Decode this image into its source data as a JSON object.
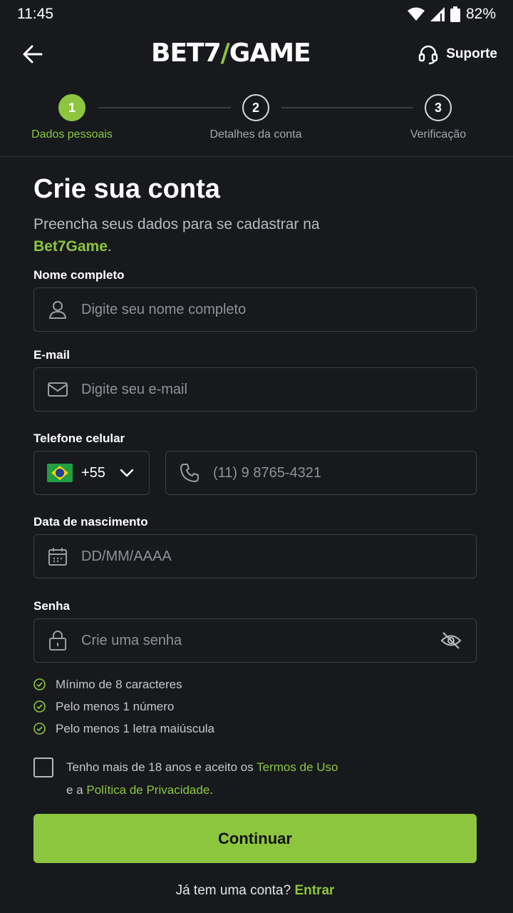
{
  "status_bar": {
    "time": "11:45",
    "battery": "82%"
  },
  "header": {
    "logo_part1": "BET7",
    "logo_part2": "GAME",
    "support_label": "Suporte"
  },
  "stepper": {
    "steps": [
      {
        "number": "1",
        "label": "Dados pessoais",
        "active": true
      },
      {
        "number": "2",
        "label": "Detalhes da conta",
        "active": false
      },
      {
        "number": "3",
        "label": "Verificação",
        "active": false
      }
    ]
  },
  "form": {
    "title": "Crie sua conta",
    "subtitle_prefix": "Preencha seus dados para se cadastrar na ",
    "subtitle_brand": "Bet7Game",
    "subtitle_suffix": ".",
    "name": {
      "label": "Nome completo",
      "placeholder": "Digite seu nome completo"
    },
    "email": {
      "label": "E-mail",
      "placeholder": "Digite seu e-mail"
    },
    "phone": {
      "label": "Telefone celular",
      "country_code": "+55",
      "placeholder": "(11) 9 8765-4321"
    },
    "birthdate": {
      "label": "Data de nascimento",
      "placeholder": "DD/MM/AAAA"
    },
    "password": {
      "label": "Senha",
      "placeholder": "Crie uma senha",
      "rules": [
        "Mínimo de 8 caracteres",
        "Pelo menos 1 número",
        "Pelo menos 1 letra maiúscula"
      ]
    },
    "terms": {
      "text1": "Tenho mais de 18 anos e aceito os ",
      "terms_link": "Termos de Uso",
      "text2": "e a ",
      "privacy_link": "Política de Privacidade",
      "text3": "."
    },
    "submit_label": "Continuar",
    "login_prompt": "Já tem uma conta? ",
    "login_link": "Entrar"
  },
  "colors": {
    "accent": "#8cc63f",
    "background": "#17191d",
    "border": "#3a3e45"
  }
}
